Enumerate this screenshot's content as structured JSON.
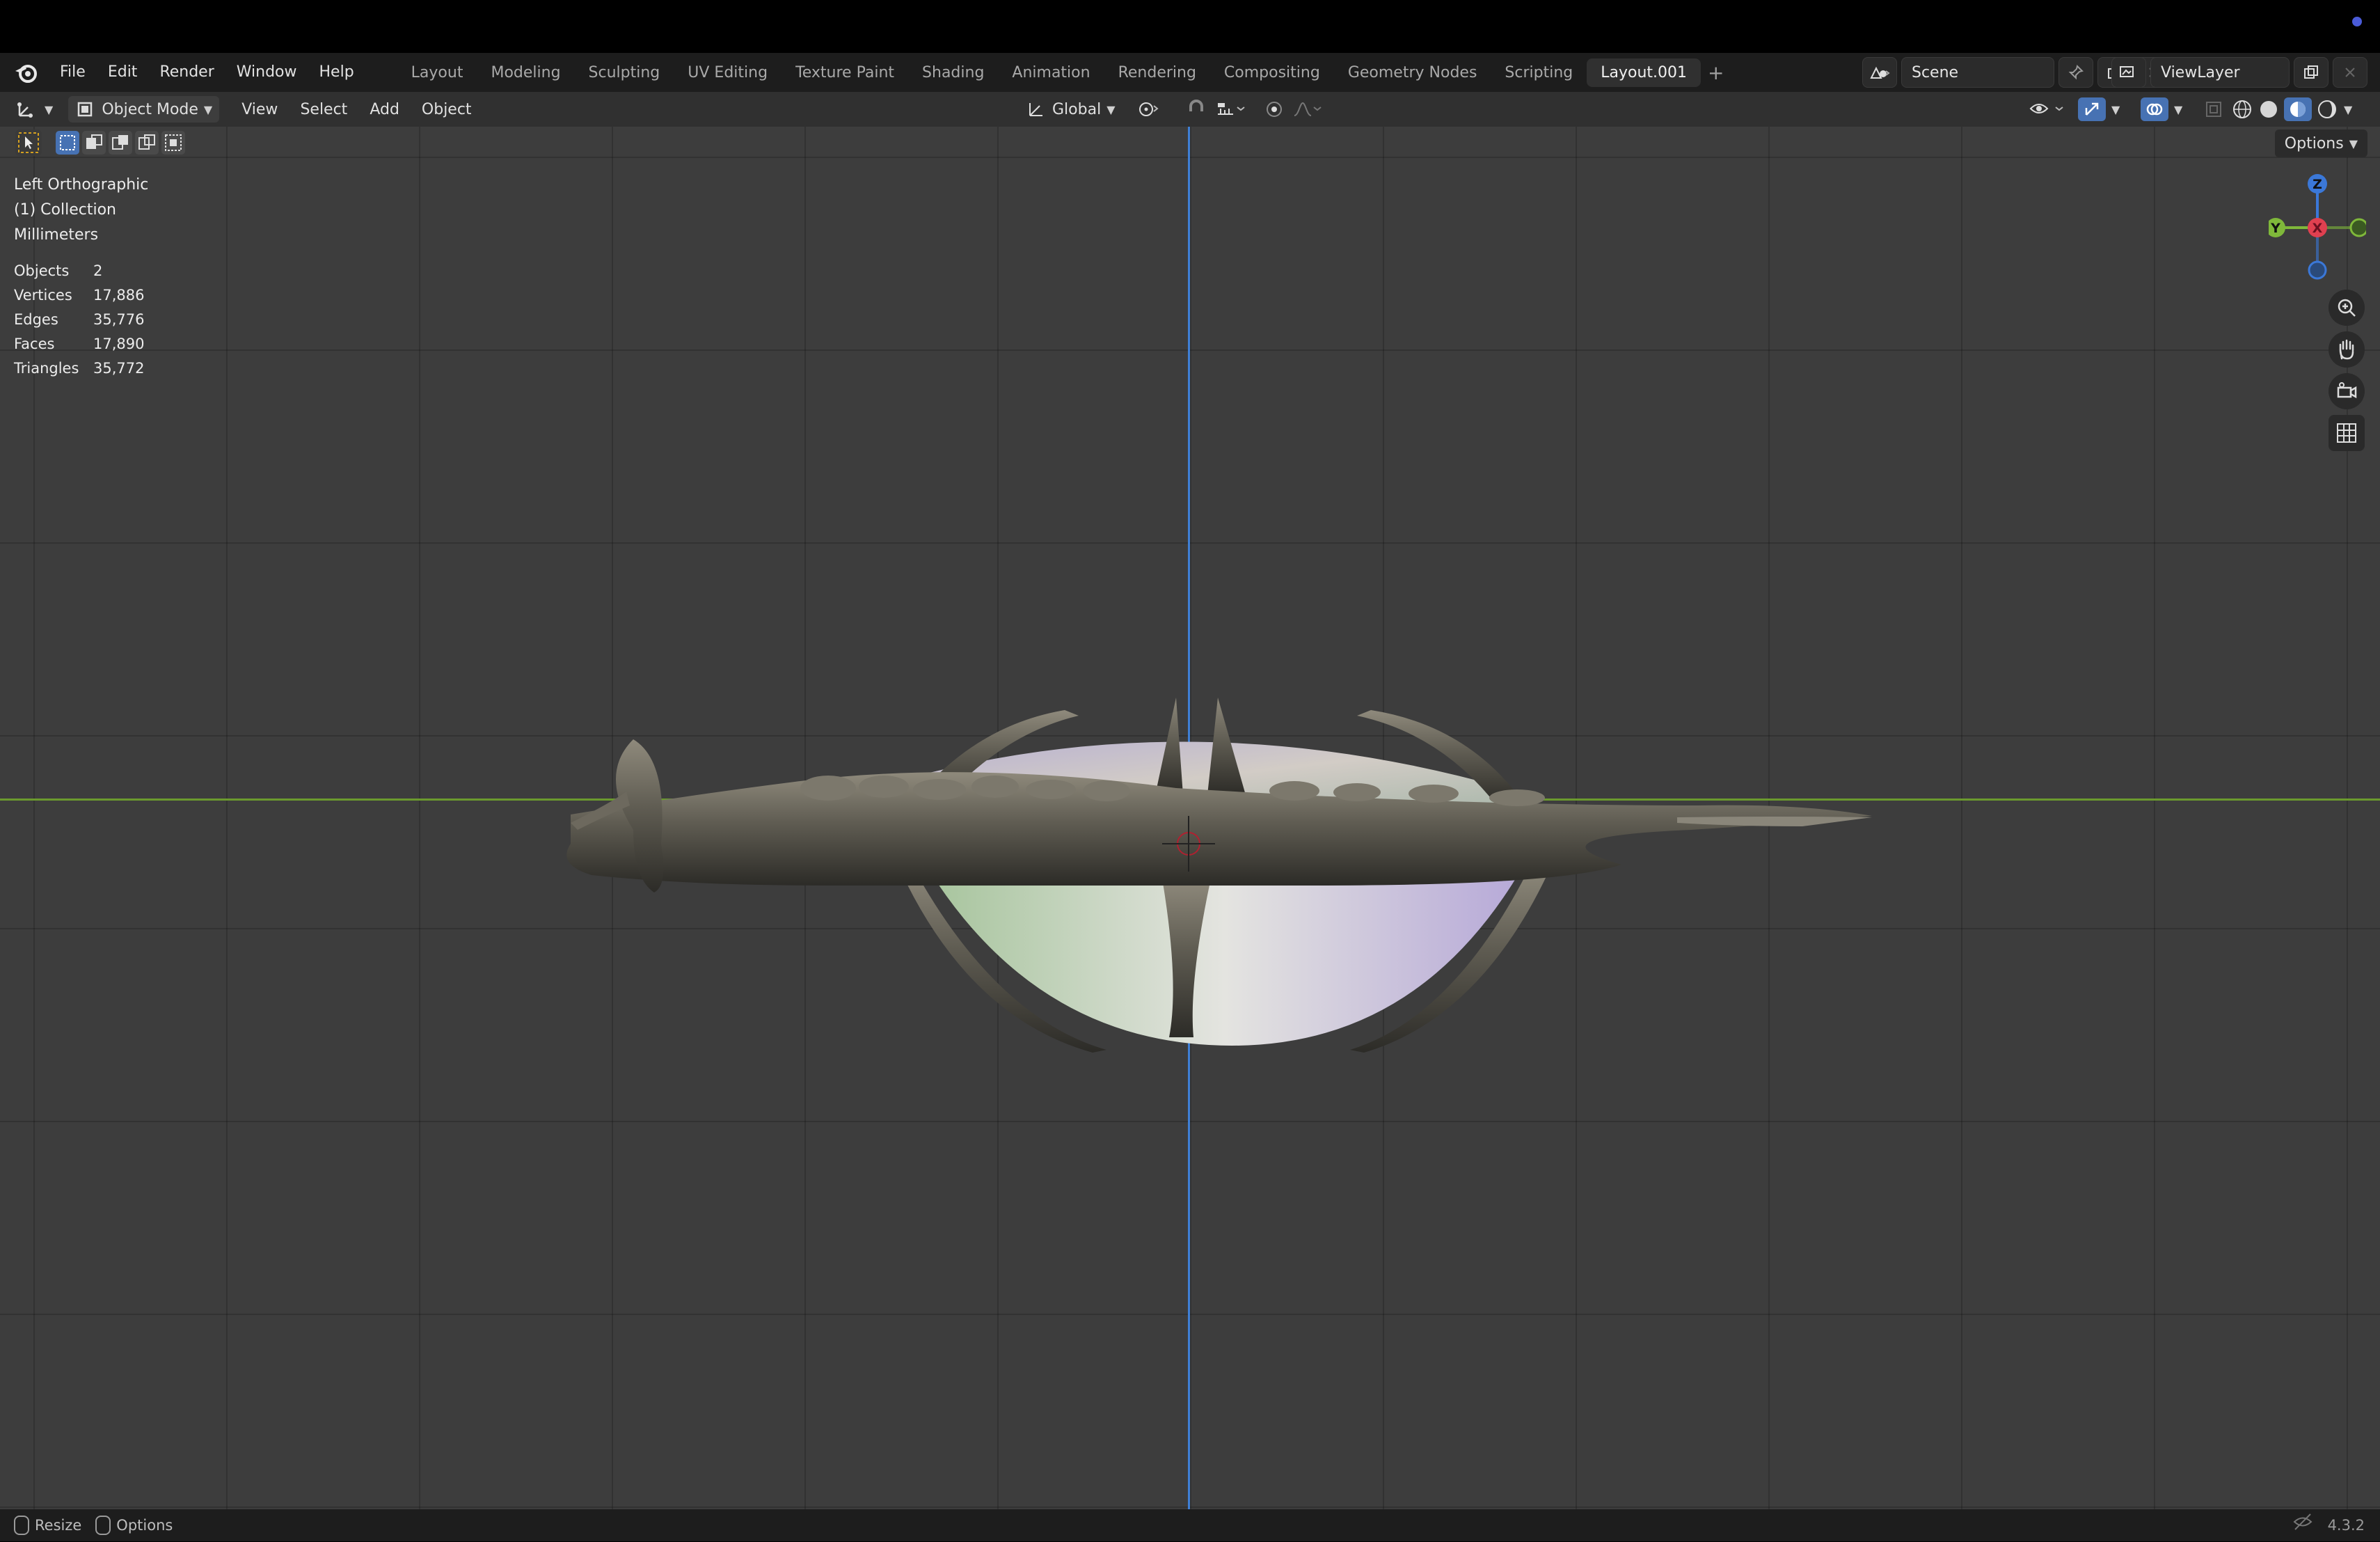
{
  "app": {
    "menu": [
      "File",
      "Edit",
      "Render",
      "Window",
      "Help"
    ],
    "workspace_tabs": [
      "Layout",
      "Modeling",
      "Sculpting",
      "UV Editing",
      "Texture Paint",
      "Shading",
      "Animation",
      "Rendering",
      "Compositing",
      "Geometry Nodes",
      "Scripting",
      "Layout.001"
    ],
    "active_tab": "Layout.001",
    "add_tab": "+",
    "scene": "Scene",
    "view_layer": "ViewLayer"
  },
  "viewport_header": {
    "mode": "Object Mode",
    "menus": [
      "View",
      "Select",
      "Add",
      "Object"
    ],
    "orientation": "Global",
    "options": "Options"
  },
  "viewport": {
    "view_name": "Left Orthographic",
    "collection": "(1) Collection",
    "units": "Millimeters",
    "stats": [
      {
        "label": "Objects",
        "value": "2"
      },
      {
        "label": "Vertices",
        "value": "17,886"
      },
      {
        "label": "Edges",
        "value": "35,776"
      },
      {
        "label": "Faces",
        "value": "17,890"
      },
      {
        "label": "Triangles",
        "value": "35,772"
      }
    ],
    "gizmo": {
      "z": "Z",
      "y": "Y",
      "x": "X"
    },
    "colors": {
      "x_axis": "#e04050",
      "y_axis": "#7fb83a",
      "z_axis": "#3b78d8"
    }
  },
  "statusbar": {
    "resize": "Resize",
    "options": "Options",
    "version": "4.3.2"
  }
}
